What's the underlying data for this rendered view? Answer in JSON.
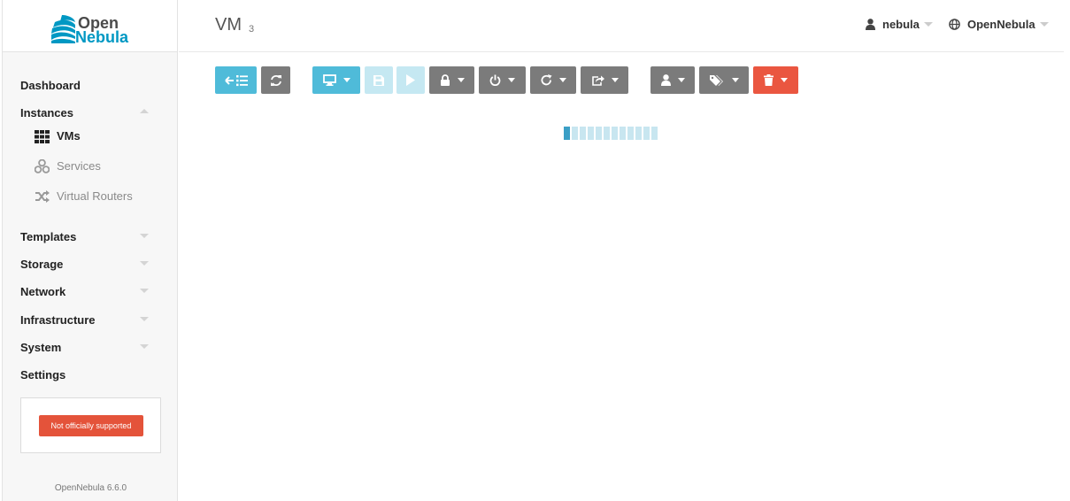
{
  "brand": {
    "line1": "Open",
    "line2": "Nebula"
  },
  "sidebar": {
    "items": [
      {
        "label": "Dashboard"
      },
      {
        "label": "Instances"
      },
      {
        "label": "Templates"
      },
      {
        "label": "Storage"
      },
      {
        "label": "Network"
      },
      {
        "label": "Infrastructure"
      },
      {
        "label": "System"
      },
      {
        "label": "Settings"
      }
    ],
    "subitems": [
      {
        "label": "VMs",
        "icon": "grid-icon"
      },
      {
        "label": "Services",
        "icon": "cubes-icon"
      },
      {
        "label": "Virtual Routers",
        "icon": "shuffle-icon"
      }
    ],
    "support_badge": "Not officially supported",
    "version": "OpenNebula 6.6.0"
  },
  "header": {
    "title": "VM",
    "count": "3",
    "user": "nebula",
    "zone": "OpenNebula"
  },
  "toolbar": {
    "buttons": [
      {
        "name": "back-to-list",
        "icon": "arrow-list-icon",
        "color": "#4fbbd9"
      },
      {
        "name": "refresh",
        "icon": "sync-icon",
        "color": "#7b7b7b"
      },
      {
        "name": "console",
        "icon": "monitor-icon",
        "color": "#4fbbd9"
      },
      {
        "name": "save",
        "icon": "save-icon",
        "color": "#c5e8f2"
      },
      {
        "name": "play",
        "icon": "play-icon",
        "color": "#c5e8f2"
      },
      {
        "name": "lock",
        "icon": "lock-icon",
        "color": "#7b7b7b"
      },
      {
        "name": "power",
        "icon": "power-icon",
        "color": "#7b7b7b"
      },
      {
        "name": "reboot",
        "icon": "redo-icon",
        "color": "#7b7b7b"
      },
      {
        "name": "migrate",
        "icon": "share-icon",
        "color": "#7b7b7b"
      },
      {
        "name": "owner",
        "icon": "user-icon",
        "color": "#7b7b7b"
      },
      {
        "name": "labels",
        "icon": "tags-icon",
        "color": "#7b7b7b"
      },
      {
        "name": "delete",
        "icon": "trash-icon",
        "color": "#ea5640"
      }
    ]
  },
  "loader": {
    "segments": 12,
    "active": 1
  }
}
